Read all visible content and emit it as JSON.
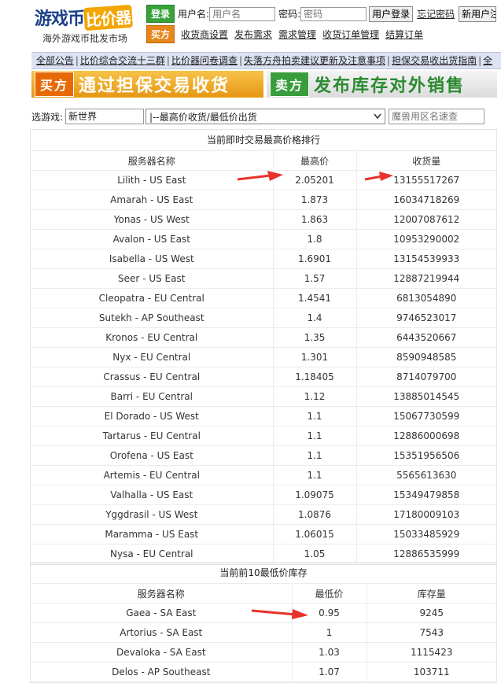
{
  "header": {
    "logo_text_a": "游戏币",
    "logo_text_b": "比价器",
    "logo_sub": "海外游戏币批发市场",
    "login_badge": "登录",
    "username_label": "用户名:",
    "username_placeholder": "用户名",
    "password_label": "密码:",
    "password_placeholder": "密码",
    "login_button": "用户登录",
    "forgot_password": "忘记密码",
    "register_button": "新用户注册",
    "buyer_badge": "买方",
    "buyer_links": [
      "收货商设置",
      "发布需求",
      "需求管理",
      "收货订单管理",
      "结算订单"
    ]
  },
  "notice": {
    "links": [
      "全部公告",
      "比价综合交流十三群",
      "比价器问卷调查",
      "失落方舟拍卖建议更新及注意事项",
      "担保交易收出货指南",
      "全"
    ]
  },
  "banners": {
    "buy_tag": "买方",
    "buy_text": "通过担保交易收货",
    "sell_tag": "卖方",
    "sell_text": "发布库存对外销售"
  },
  "filter": {
    "game_label": "选游戏:",
    "game_value": "新世界",
    "mode_value": "|--最高价收货/最低价出货",
    "server_placeholder": "魔兽用区名速查"
  },
  "highest_table": {
    "caption": "当前即时交易最高价格排行",
    "headers": [
      "服务器名称",
      "最高价",
      "收货量"
    ],
    "rows": [
      [
        "Lilith - US East",
        "2.05201",
        "13155517267"
      ],
      [
        "Amarah - US East",
        "1.873",
        "16034718269"
      ],
      [
        "Yonas - US West",
        "1.863",
        "12007087612"
      ],
      [
        "Avalon - US East",
        "1.8",
        "10953290002"
      ],
      [
        "Isabella - US West",
        "1.6901",
        "13154539933"
      ],
      [
        "Seer - US East",
        "1.57",
        "12887219944"
      ],
      [
        "Cleopatra - EU Central",
        "1.4541",
        "6813054890"
      ],
      [
        "Sutekh - AP Southeast",
        "1.4",
        "9746523017"
      ],
      [
        "Kronos - EU Central",
        "1.35",
        "6443520667"
      ],
      [
        "Nyx - EU Central",
        "1.301",
        "8590948585"
      ],
      [
        "Crassus - EU Central",
        "1.18405",
        "8714079700"
      ],
      [
        "Barri - EU Central",
        "1.12",
        "13885014545"
      ],
      [
        "El Dorado - US West",
        "1.1",
        "15067730599"
      ],
      [
        "Tartarus - EU Central",
        "1.1",
        "12886000698"
      ],
      [
        "Orofena - US East",
        "1.1",
        "15351956506"
      ],
      [
        "Artemis - EU Central",
        "1.1",
        "5565613630"
      ],
      [
        "Valhalla - US East",
        "1.09075",
        "15349479858"
      ],
      [
        "Yggdrasil - US West",
        "1.0876",
        "17180009103"
      ],
      [
        "Maramma - US East",
        "1.06015",
        "15033485929"
      ],
      [
        "Nysa - EU Central",
        "1.05",
        "12886535999"
      ]
    ]
  },
  "lowest_table": {
    "caption": "当前前10最低价库存",
    "headers": [
      "服务器名称",
      "最低价",
      "库存量"
    ],
    "rows": [
      [
        "Gaea - SA East",
        "0.95",
        "9245"
      ],
      [
        "Artorius - SA East",
        "1",
        "7543"
      ],
      [
        "Devaloka - SA East",
        "1.03",
        "1115423"
      ],
      [
        "Delos - AP Southeast",
        "1.07",
        "103711"
      ]
    ]
  },
  "colors": {
    "arrow": "#e8322b",
    "buy_orange": "#e86a07",
    "sell_green": "#3a9d3d",
    "notice_bg": "#dde3f2"
  }
}
